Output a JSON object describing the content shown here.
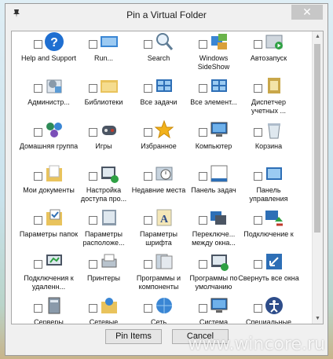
{
  "window": {
    "title": "Pin a Virtual Folder",
    "close_glyph": "✕"
  },
  "items": [
    {
      "label": "Help and Support",
      "icon": "help-icon"
    },
    {
      "label": "Run...",
      "icon": "run-icon"
    },
    {
      "label": "Search",
      "icon": "search-icon"
    },
    {
      "label": "Windows SideShow",
      "icon": "sideshow-icon"
    },
    {
      "label": "Автозапуск",
      "icon": "autoplay-icon"
    },
    {
      "label": "Администр...",
      "icon": "admin-tools-icon"
    },
    {
      "label": "Библиотеки",
      "icon": "libraries-icon"
    },
    {
      "label": "Все задачи",
      "icon": "all-tasks-icon"
    },
    {
      "label": "Все элемент...",
      "icon": "all-items-icon"
    },
    {
      "label": "Диспетчер учетных ...",
      "icon": "credential-manager-icon"
    },
    {
      "label": "Домашняя группа",
      "icon": "homegroup-icon"
    },
    {
      "label": "Игры",
      "icon": "games-icon"
    },
    {
      "label": "Избранное",
      "icon": "favorites-star-icon"
    },
    {
      "label": "Компьютер",
      "icon": "computer-icon"
    },
    {
      "label": "Корзина",
      "icon": "recycle-bin-icon"
    },
    {
      "label": "Мои документы",
      "icon": "documents-folder-icon"
    },
    {
      "label": "Настройка доступа про...",
      "icon": "default-access-icon"
    },
    {
      "label": "Недавние места",
      "icon": "recent-places-icon"
    },
    {
      "label": "Панель задач",
      "icon": "taskbar-icon"
    },
    {
      "label": "Панель управления",
      "icon": "control-panel-icon"
    },
    {
      "label": "Параметры папок",
      "icon": "folder-options-icon"
    },
    {
      "label": "Параметры расположе...",
      "icon": "location-settings-icon"
    },
    {
      "label": "Параметры шрифта",
      "icon": "fonts-icon"
    },
    {
      "label": "Переключе... между окна...",
      "icon": "switch-windows-icon"
    },
    {
      "label": "Подключение к",
      "icon": "connect-to-icon"
    },
    {
      "label": "Подключения к удаленн...",
      "icon": "remote-connections-icon"
    },
    {
      "label": "Принтеры",
      "icon": "printers-icon"
    },
    {
      "label": "Программы и компоненты",
      "icon": "programs-features-icon"
    },
    {
      "label": "Программы по умолчанию",
      "icon": "default-programs-icon"
    },
    {
      "label": "Свернуть все окна",
      "icon": "minimize-all-icon"
    },
    {
      "label": "Серверы",
      "icon": "servers-icon"
    },
    {
      "label": "Сетевые",
      "icon": "network-folders-icon"
    },
    {
      "label": "Сеть",
      "icon": "network-icon"
    },
    {
      "label": "Система",
      "icon": "system-icon"
    },
    {
      "label": "Специальные",
      "icon": "accessibility-icon"
    }
  ],
  "buttons": {
    "pin": "Pin Items",
    "cancel": "Cancel"
  },
  "watermark": "www.wincore.ru"
}
